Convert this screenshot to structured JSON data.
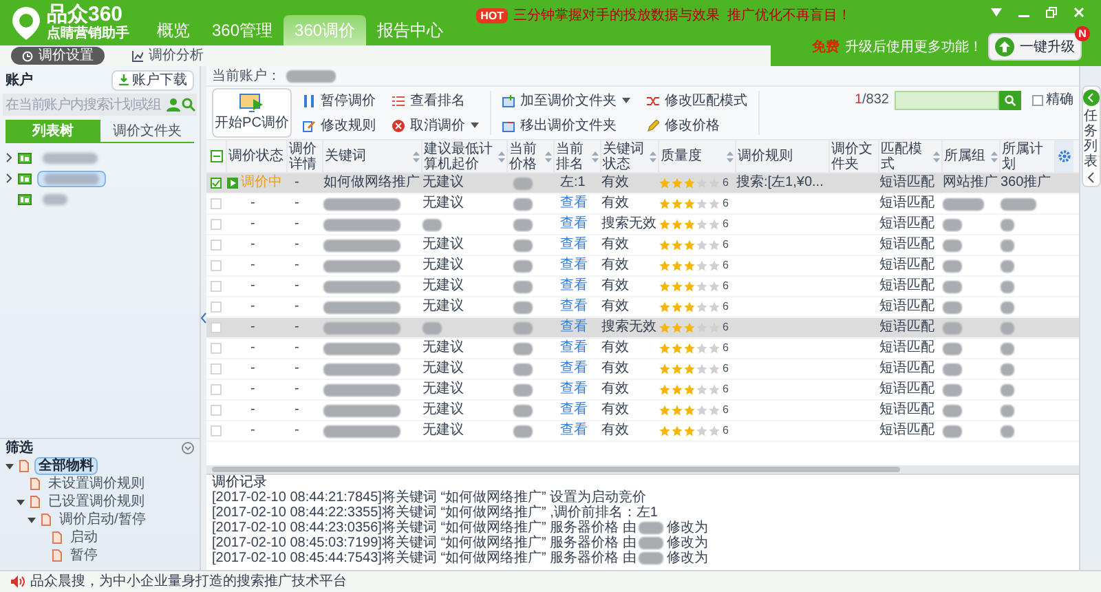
{
  "app": {
    "name": "品众360",
    "tagline": "点睛营销助手"
  },
  "nav_tabs": [
    {
      "label": "概览",
      "selected": false
    },
    {
      "label": "360管理",
      "selected": false
    },
    {
      "label": "360调价",
      "selected": true
    },
    {
      "label": "报告中心",
      "selected": false
    }
  ],
  "promo": {
    "badge": "HOT",
    "text": "三分钟掌握对手的投放数据与效果  推广优化不再盲目！"
  },
  "sub_tabs": [
    {
      "label": "调价设置",
      "selected": true
    },
    {
      "label": "调价分析",
      "selected": false
    }
  ],
  "upgrade": {
    "prefix": "免费",
    "text": "升级后使用更多功能！",
    "button": "一键升级",
    "badge": "N"
  },
  "account_panel": {
    "title": "账户",
    "download_button": "账户下载",
    "search_placeholder": "在当前账户内搜索计划或组",
    "tabs": [
      {
        "label": "列表树",
        "selected": true
      },
      {
        "label": "调价文件夹",
        "selected": false
      }
    ],
    "tree": [
      {
        "expandable": true,
        "selected": false
      },
      {
        "expandable": true,
        "selected": true
      },
      {
        "expandable": false,
        "selected": false
      }
    ]
  },
  "filter_panel": {
    "title": "筛选",
    "tree": [
      {
        "label": "全部物料",
        "selected": true,
        "expanded": true,
        "children": [
          {
            "label": "未设置调价规则",
            "selected": false
          },
          {
            "label": "已设置调价规则",
            "selected": false,
            "expanded": true,
            "children": [
              {
                "label": "调价启动/暂停",
                "selected": false,
                "expanded": true,
                "children": [
                  {
                    "label": "启动",
                    "selected": false
                  },
                  {
                    "label": "暂停",
                    "selected": false
                  }
                ]
              }
            ]
          }
        ]
      }
    ]
  },
  "current_account": {
    "label": "当前账户："
  },
  "toolbar": {
    "primary": "开始PC调价",
    "groups": [
      [
        {
          "label": "暂停调价",
          "dropdown": false
        },
        {
          "label": "修改规则",
          "dropdown": false
        }
      ],
      [
        {
          "label": "查看排名",
          "dropdown": false
        },
        {
          "label": "取消调价",
          "dropdown": true
        }
      ],
      [
        {
          "label": "加至调价文件夹",
          "dropdown": true
        },
        {
          "label": "移出调价文件夹",
          "dropdown": false
        }
      ],
      [
        {
          "label": "修改匹配模式",
          "dropdown": false
        },
        {
          "label": "修改价格",
          "dropdown": false
        }
      ]
    ]
  },
  "pagination": {
    "current": "1",
    "total": "/832"
  },
  "exact_match": {
    "label": "精确",
    "checked": false
  },
  "table": {
    "columns": [
      {
        "label": "调价状态",
        "sortable": false
      },
      {
        "label": "调价详情",
        "sortable": false
      },
      {
        "label": "关键词",
        "sortable": true
      },
      {
        "label": "建议最低计算机起价",
        "sortable": true
      },
      {
        "label": "当前价格",
        "sortable": true
      },
      {
        "label": "当前排名",
        "sortable": true
      },
      {
        "label": "关键词状态",
        "sortable": true
      },
      {
        "label": "质量度",
        "sortable": true
      },
      {
        "label": "调价规则",
        "sortable": false
      },
      {
        "label": "调价文件夹",
        "sortable": false
      },
      {
        "label": "匹配模式",
        "sortable": true
      },
      {
        "label": "所属组",
        "sortable": true
      },
      {
        "label": "所属计划",
        "sortable": false
      }
    ],
    "rows": [
      {
        "selected": true,
        "checked": true,
        "status": {
          "kind": "running",
          "text": "调价中"
        },
        "detail": "-",
        "keyword": "如何做网络推广",
        "suggestion": "无建议",
        "rank": {
          "kind": "text",
          "text": "左:1"
        },
        "keyword_status": "有效",
        "stars": 3,
        "quality": "6",
        "rule": "搜索:[左1,¥0...",
        "match": "短语匹配",
        "group": "网站推广",
        "plan": "360推广"
      },
      {
        "selected": false,
        "checked": false,
        "status": {
          "kind": "none",
          "text": "-"
        },
        "detail": "-",
        "suggestion": "无建议",
        "rank": {
          "kind": "link",
          "text": "查看"
        },
        "keyword_status": "有效",
        "stars": 3,
        "quality": "6",
        "match": "短语匹配"
      },
      {
        "selected": false,
        "checked": false,
        "status": {
          "kind": "none",
          "text": "-"
        },
        "detail": "-",
        "rank": {
          "kind": "link",
          "text": "查看"
        },
        "keyword_status": "搜索无效",
        "stars": 3,
        "quality": "6",
        "match": "短语匹配"
      },
      {
        "selected": false,
        "checked": false,
        "status": {
          "kind": "none",
          "text": "-"
        },
        "detail": "-",
        "suggestion": "无建议",
        "rank": {
          "kind": "link",
          "text": "查看"
        },
        "keyword_status": "有效",
        "stars": 3,
        "quality": "6",
        "match": "短语匹配"
      },
      {
        "selected": false,
        "checked": false,
        "status": {
          "kind": "none",
          "text": "-"
        },
        "detail": "-",
        "suggestion": "无建议",
        "rank": {
          "kind": "link",
          "text": "查看"
        },
        "keyword_status": "有效",
        "stars": 3,
        "quality": "6",
        "match": "短语匹配"
      },
      {
        "selected": false,
        "checked": false,
        "status": {
          "kind": "none",
          "text": "-"
        },
        "detail": "-",
        "suggestion": "无建议",
        "rank": {
          "kind": "link",
          "text": "查看"
        },
        "keyword_status": "有效",
        "stars": 3,
        "quality": "6",
        "match": "短语匹配"
      },
      {
        "selected": false,
        "checked": false,
        "status": {
          "kind": "none",
          "text": "-"
        },
        "detail": "-",
        "suggestion": "无建议",
        "rank": {
          "kind": "link",
          "text": "查看"
        },
        "keyword_status": "有效",
        "stars": 3,
        "quality": "6",
        "match": "短语匹配"
      },
      {
        "selected": true,
        "checked": false,
        "status": {
          "kind": "none",
          "text": "-"
        },
        "detail": "-",
        "rank": {
          "kind": "link",
          "text": "查看"
        },
        "keyword_status": "搜索无效",
        "stars": 3,
        "quality": "6",
        "match": "短语匹配"
      },
      {
        "selected": false,
        "checked": false,
        "status": {
          "kind": "none",
          "text": "-"
        },
        "detail": "-",
        "suggestion": "无建议",
        "rank": {
          "kind": "link",
          "text": "查看"
        },
        "keyword_status": "有效",
        "stars": 3,
        "quality": "6",
        "match": "短语匹配"
      },
      {
        "selected": false,
        "checked": false,
        "status": {
          "kind": "none",
          "text": "-"
        },
        "detail": "-",
        "suggestion": "无建议",
        "rank": {
          "kind": "link",
          "text": "查看"
        },
        "keyword_status": "有效",
        "stars": 3,
        "quality": "6",
        "match": "短语匹配"
      },
      {
        "selected": false,
        "checked": false,
        "status": {
          "kind": "none",
          "text": "-"
        },
        "detail": "-",
        "suggestion": "无建议",
        "rank": {
          "kind": "link",
          "text": "查看"
        },
        "keyword_status": "有效",
        "stars": 3,
        "quality": "6",
        "match": "短语匹配"
      },
      {
        "selected": false,
        "checked": false,
        "status": {
          "kind": "none",
          "text": "-"
        },
        "detail": "-",
        "suggestion": "无建议",
        "rank": {
          "kind": "link",
          "text": "查看"
        },
        "keyword_status": "有效",
        "stars": 3,
        "quality": "6",
        "match": "短语匹配"
      },
      {
        "selected": false,
        "checked": false,
        "status": {
          "kind": "none",
          "text": "-"
        },
        "detail": "-",
        "suggestion": "无建议",
        "rank": {
          "kind": "link",
          "text": "查看"
        },
        "keyword_status": "有效",
        "stars": 3,
        "quality": "6",
        "match": "短语匹配"
      }
    ]
  },
  "log": {
    "title": "调价记录",
    "lines": [
      {
        "text": "[2017-02-10 08:44:21:7845]将关键词 “如何做网络推广” 设置为启动竞价"
      },
      {
        "text": "[2017-02-10 08:44:22:3355]将关键词 “如何做网络推广” ,调价前排名：左1"
      },
      {
        "text": "[2017-02-10 08:44:23:0356]将关键词 “如何做网络推广” 服务器价格 由",
        "tail": "修改为"
      },
      {
        "text": "[2017-02-10 08:45:03:7199]将关键词 “如何做网络推广” 服务器价格 由",
        "tail": "修改为"
      },
      {
        "text": "[2017-02-10 08:45:44:7543]将关键词 “如何做网络推广” 服务器价格 由",
        "tail": "修改为"
      }
    ]
  },
  "task_panel": {
    "label": "任务列表"
  },
  "status_bar": {
    "text": "品众晨搜，为中小企业量身打造的搜索推广技术平台"
  }
}
